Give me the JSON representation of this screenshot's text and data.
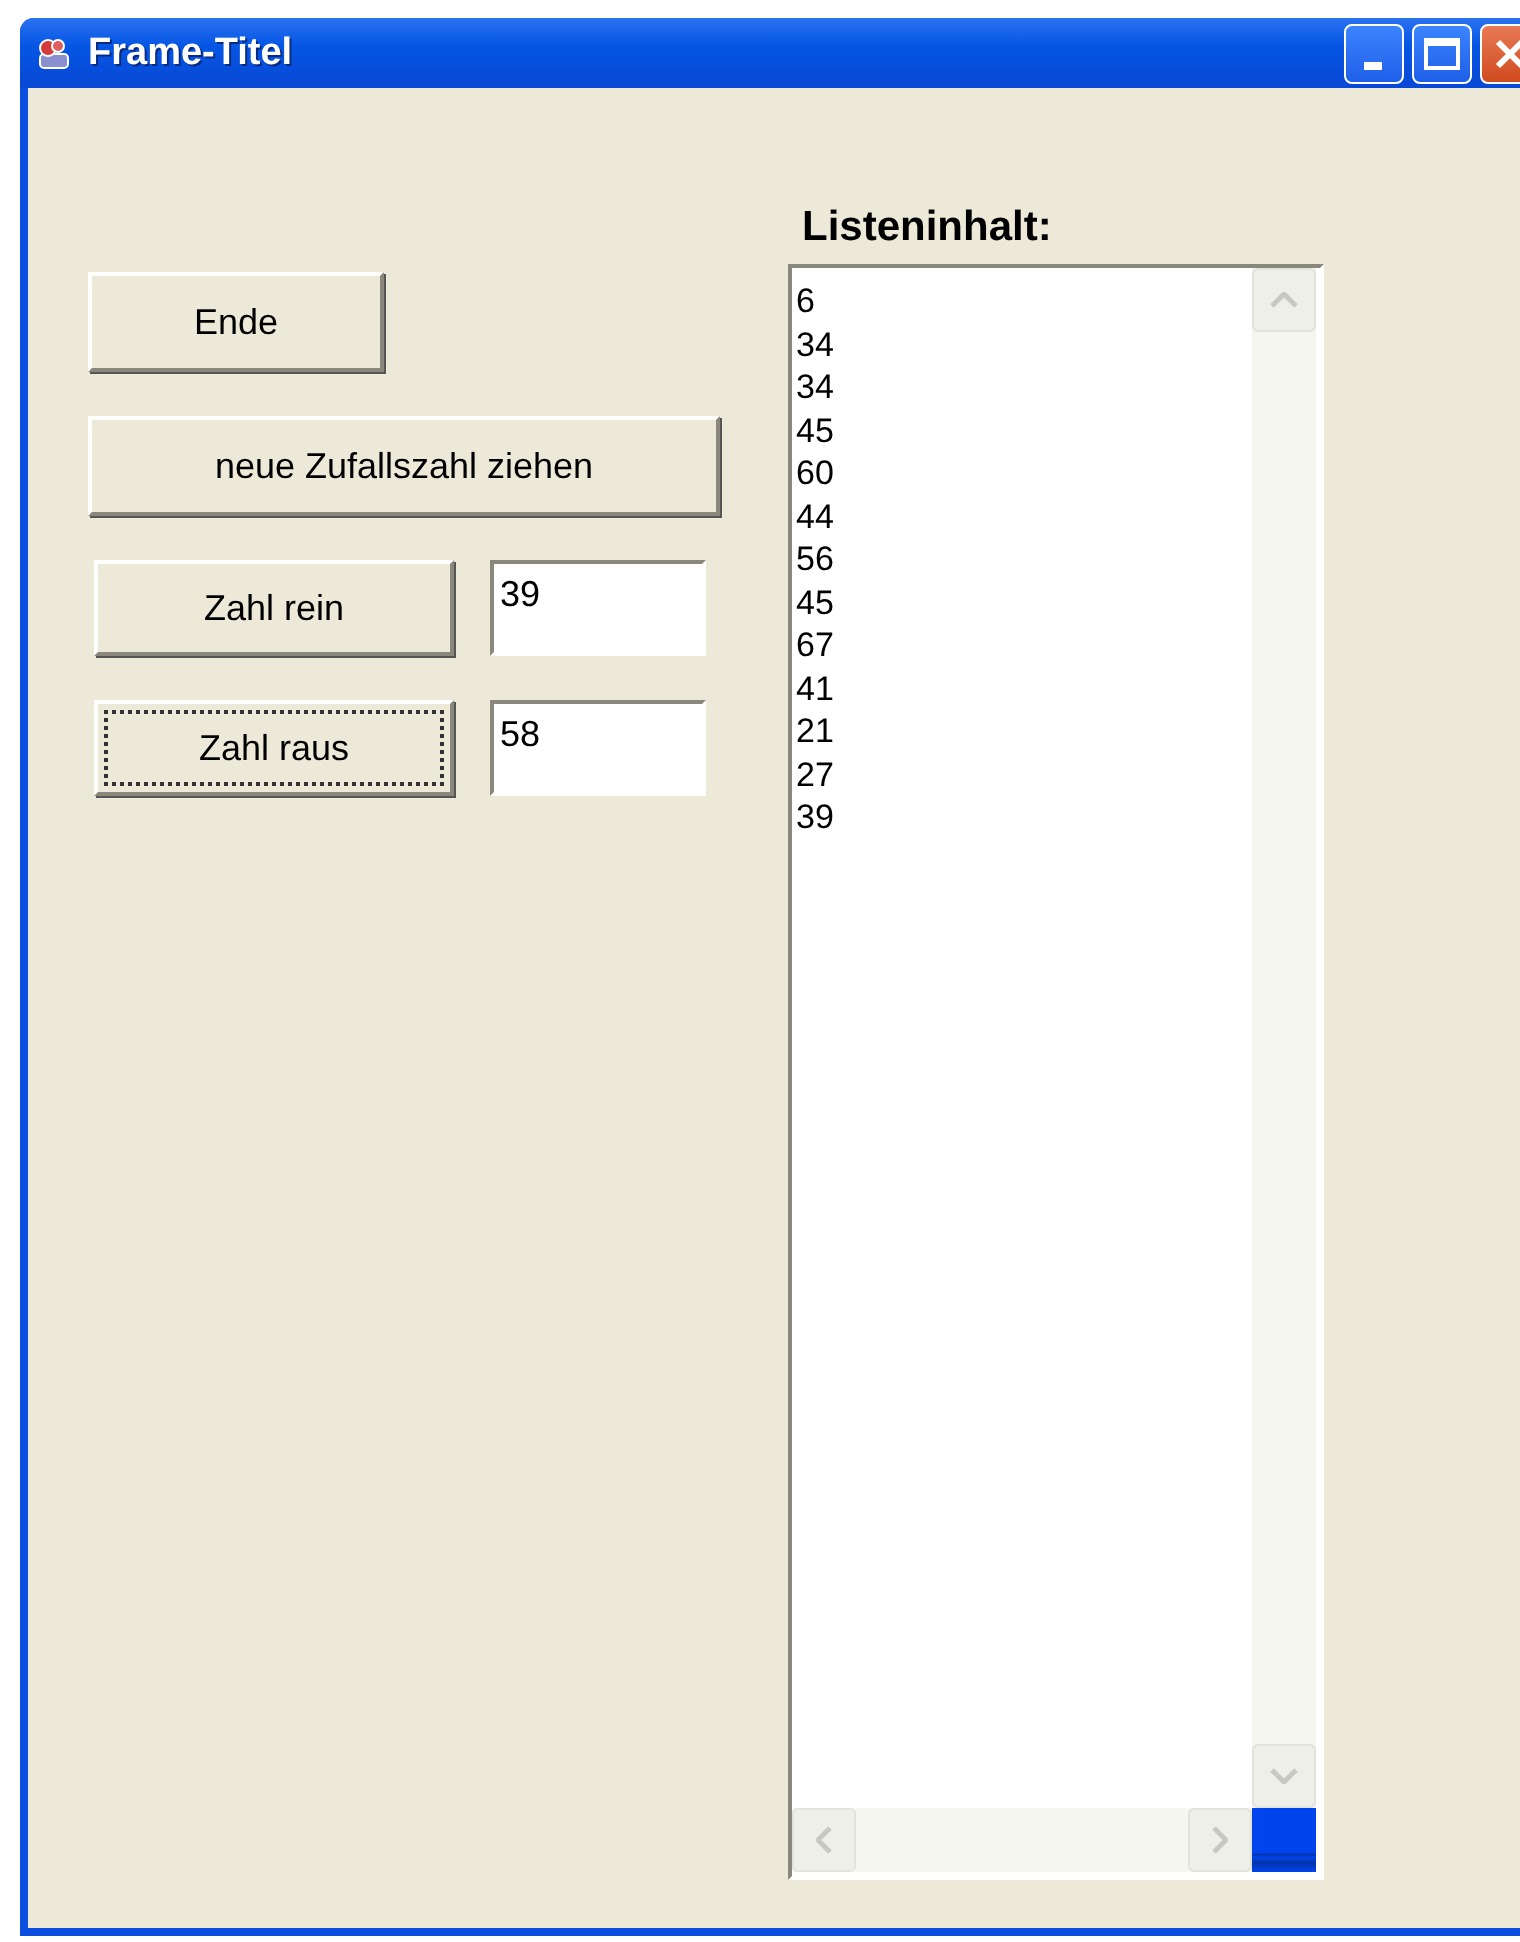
{
  "window": {
    "title": "Frame-Titel"
  },
  "buttons": [
    {
      "label": "Ende",
      "focused": false
    },
    {
      "label": "neue Zufallszahl ziehen",
      "focused": false
    }
  ],
  "rows": [
    {
      "button": {
        "label": "Zahl rein",
        "focused": false
      },
      "field": {
        "value": "39"
      }
    },
    {
      "button": {
        "label": "Zahl raus",
        "focused": true
      },
      "field": {
        "value": "58"
      }
    }
  ],
  "list": {
    "label": "Listeninhalt:",
    "items": [
      "6",
      "34",
      "34",
      "45",
      "60",
      "44",
      "56",
      "45",
      "67",
      "41",
      "21",
      "27",
      "39"
    ]
  }
}
